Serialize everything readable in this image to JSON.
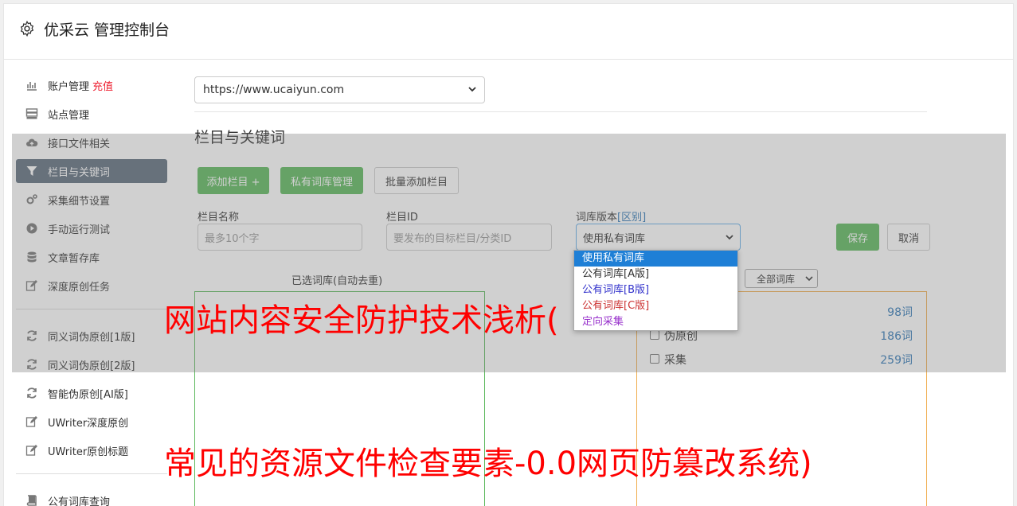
{
  "app": {
    "title": "优采云 管理控制台",
    "icon": "gear-icon"
  },
  "sidebar": {
    "items": [
      {
        "label": "账户管理",
        "extra": "充值",
        "icon": "bar-chart-icon"
      },
      {
        "label": "站点管理",
        "icon": "server-icon"
      },
      {
        "label": "接口文件相关",
        "icon": "cloud-upload-icon"
      },
      {
        "label": "栏目与关键词",
        "icon": "filter-icon",
        "active": true
      },
      {
        "label": "采集细节设置",
        "icon": "cogs-icon"
      },
      {
        "label": "手动运行测试",
        "icon": "play-circle-icon"
      },
      {
        "label": "文章暂存库",
        "icon": "database-icon"
      },
      {
        "label": "深度原创任务",
        "icon": "edit-icon"
      }
    ],
    "items2": [
      {
        "label": "同义词伪原创[1版]",
        "icon": "refresh-icon"
      },
      {
        "label": "同义词伪原创[2版]",
        "icon": "refresh-icon"
      },
      {
        "label": "智能伪原创[AI版]",
        "icon": "refresh-icon"
      },
      {
        "label": "UWriter深度原创",
        "icon": "edit-icon"
      },
      {
        "label": "UWriter原创标题",
        "icon": "edit-icon"
      }
    ],
    "items3": [
      {
        "label": "公有词库查询",
        "icon": "book-icon"
      }
    ]
  },
  "main": {
    "site_select": "https://www.ucaiyun.com",
    "section_title": "栏目与关键词",
    "buttons": {
      "add_column": "添加栏目 +",
      "private_lib": "私有词库管理",
      "batch_add": "批量添加栏目",
      "save": "保存",
      "cancel": "取消"
    },
    "fields": {
      "column_name_label": "栏目名称",
      "column_name_placeholder": "最多10个字",
      "column_id_label": "栏目ID",
      "column_id_placeholder": "要发布的目标栏目/分类ID",
      "lib_version_label": "词库版本",
      "lib_version_link": "[区别]",
      "lib_version_value": "使用私有词库"
    },
    "dropdown_options": [
      {
        "label": "使用私有词库",
        "color": "#ffffff",
        "selected": true
      },
      {
        "label": "公有词库[A版]",
        "color": "#333333"
      },
      {
        "label": "公有词库[B版]",
        "color": "#3333cc"
      },
      {
        "label": "公有词库[C版]",
        "color": "#cc3333"
      },
      {
        "label": "定向采集",
        "color": "#9933cc"
      }
    ],
    "selected_caption": "已选词库(自动去重)",
    "all_lib_select": "全部词库",
    "libraries": [
      {
        "name": "",
        "count": "98词"
      },
      {
        "name": "伪原创",
        "count": "186词"
      },
      {
        "name": "采集",
        "count": "259词"
      }
    ]
  },
  "overlay_text": {
    "line1": "网站内容安全防护技术浅析(",
    "line2": "常见的资源文件检查要素-0.0网页防篡改系统)"
  },
  "colors": {
    "green": "#5cb85c",
    "active_nav": "#5e6d7d",
    "link": "#337ab7",
    "overlay_text": "#ff0000"
  }
}
